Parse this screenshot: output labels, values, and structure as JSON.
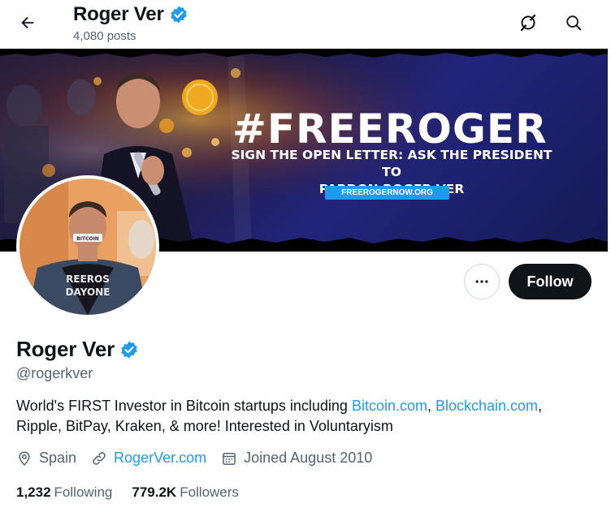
{
  "header": {
    "name": "Roger Ver",
    "posts": "4,080 posts",
    "icons": [
      "back-arrow-icon",
      "verified-badge-icon",
      "grok-icon",
      "search-icon"
    ]
  },
  "banner": {
    "headline": "#FREEROGER",
    "subline_1": "SIGN THE OPEN LETTER: ASK THE PRESIDENT TO",
    "subline_2": "PARDON  ROGER VER",
    "url": "FREEROGERNOW.ORG"
  },
  "avatar": {
    "shirt_line_1": "REEROS",
    "shirt_line_2": "DAYONE",
    "tape_text": "BITCOIN"
  },
  "actions": {
    "more_label": "···",
    "follow_label": "Follow"
  },
  "profile": {
    "name": "Roger Ver",
    "handle": "@rogerkver",
    "bio": {
      "part1": "World's FIRST Investor in Bitcoin startups including ",
      "link1": "Bitcoin.com",
      "sep": ", ",
      "link2": "Blockchain.com",
      "part2": ",",
      "line2": "Ripple, BitPay, Kraken, & more! Interested in Voluntaryism"
    },
    "location": "Spain",
    "website": "RogerVer.com",
    "joined": "Joined August 2010",
    "following_count": "1,232",
    "following_label": "Following",
    "followers_count": "779.2K",
    "followers_label": "Followers"
  },
  "colors": {
    "accent": "#1d9bf0",
    "text": "#0f1419",
    "secondary": "#536471",
    "banner_bg": "#1d1b45"
  }
}
